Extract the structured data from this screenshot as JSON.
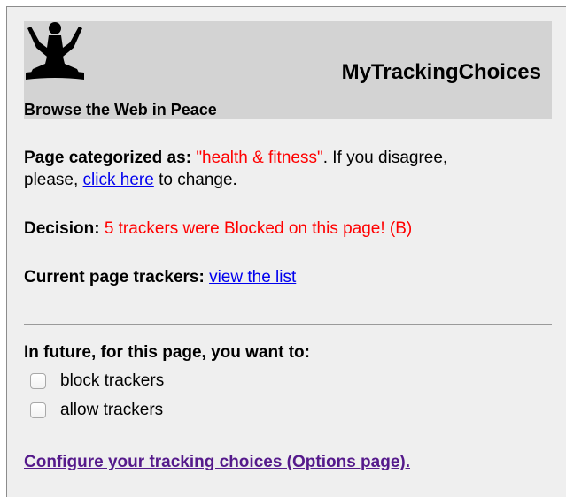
{
  "header": {
    "app_title": "MyTrackingChoices",
    "tagline": "Browse the Web in Peace",
    "logo_icon": "meditating-person-icon"
  },
  "category": {
    "label": "Page categorized as:",
    "value": "\"health & fitness\"",
    "text_after": ". If you disagree,",
    "line2_before": "please, ",
    "link": "click here",
    "line2_after": " to change."
  },
  "decision": {
    "label": "Decision:",
    "value": "5 trackers were Blocked on this page! (B)"
  },
  "trackers": {
    "label": "Current page trackers:",
    "link": "view the list"
  },
  "future": {
    "heading": "In future, for this page, you want to:",
    "options": [
      {
        "label": "block trackers",
        "checked": false
      },
      {
        "label": "allow trackers",
        "checked": false
      }
    ]
  },
  "configure_link": "Configure your tracking choices (Options page).",
  "colors": {
    "header_bg": "#d3d3d3",
    "panel_bg": "#efefef",
    "highlight_red": "#ff0000",
    "link_blue": "#0000ee",
    "link_visited": "#551a8b"
  }
}
